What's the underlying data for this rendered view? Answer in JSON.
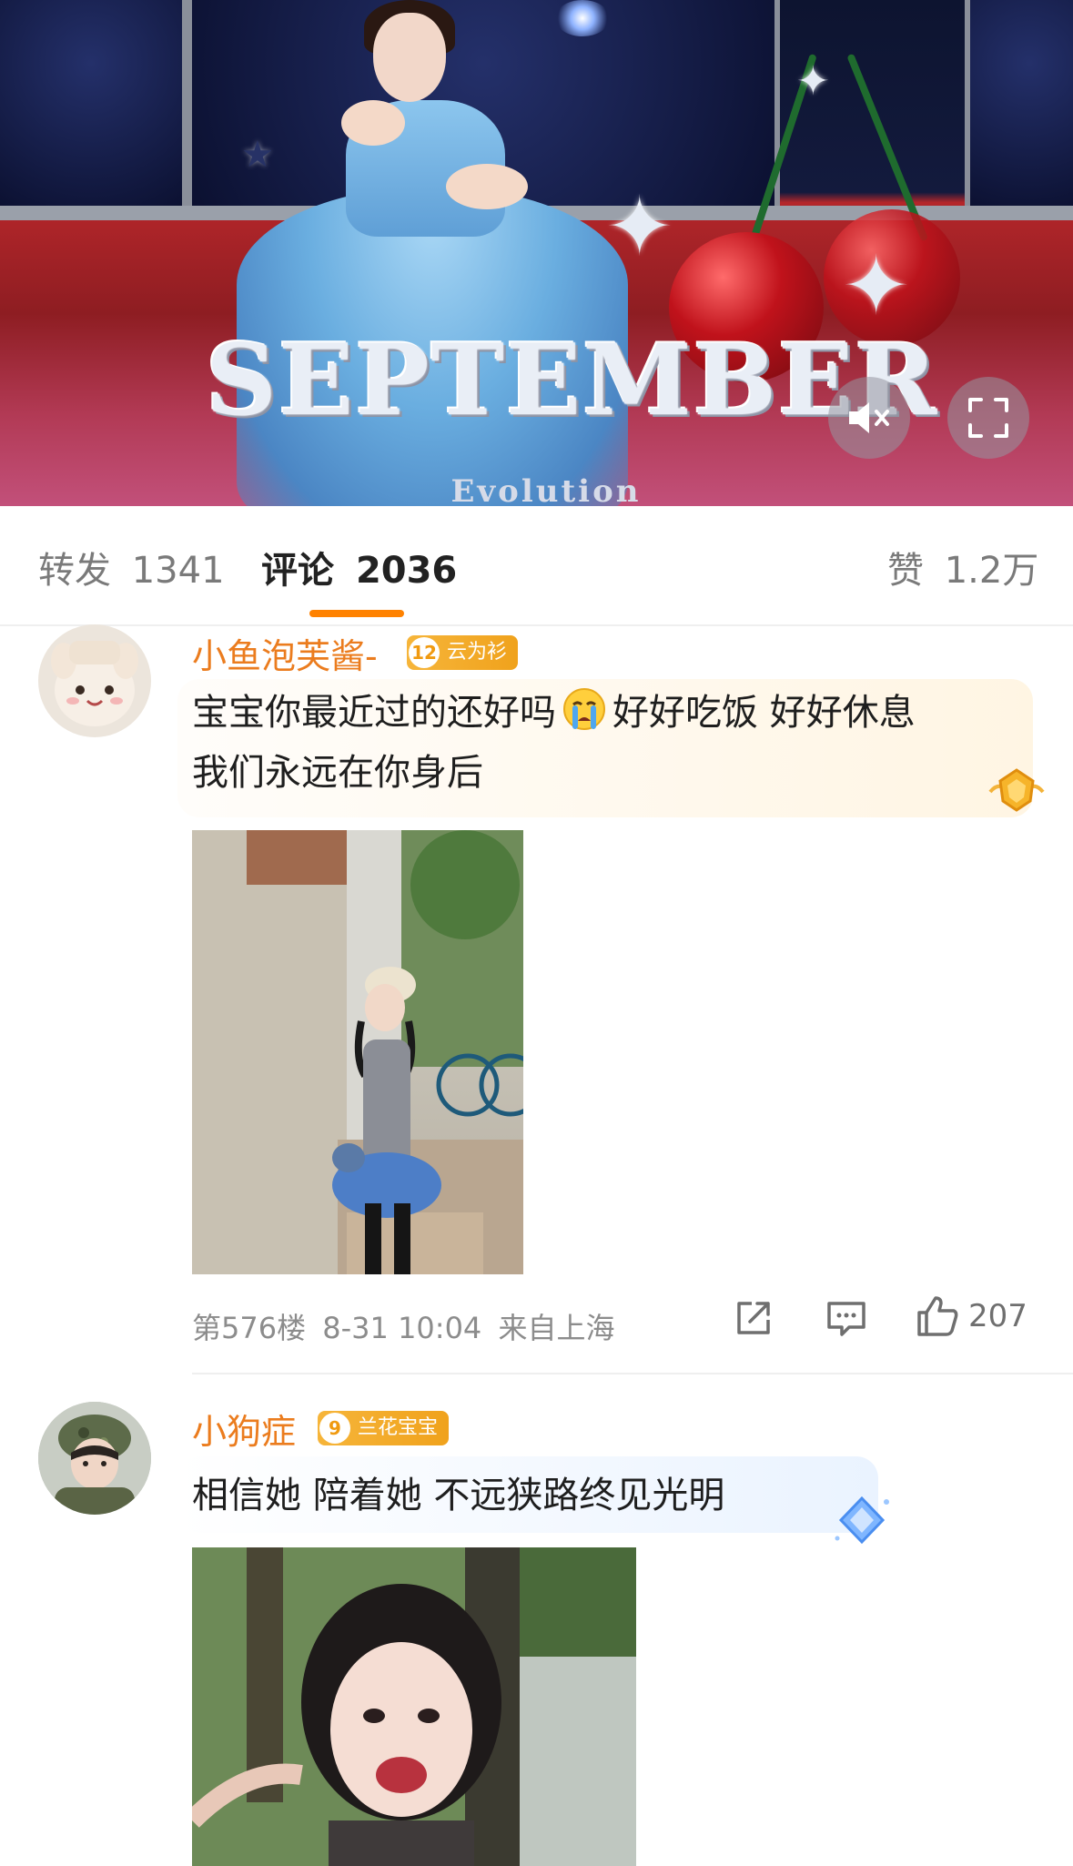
{
  "video": {
    "title_graphic_text": "SEPTEMBER",
    "subtitle_graphic_text": "Evolution",
    "mute_icon": "volume-mute-icon",
    "fullscreen_icon": "fullscreen-icon"
  },
  "tabs": {
    "repost": {
      "label": "转发",
      "count": "1341"
    },
    "comments": {
      "label": "评论",
      "count": "2036"
    },
    "likes": {
      "label": "赞",
      "count": "1.2万"
    },
    "active": "comments",
    "accent_color": "#ff8200"
  },
  "comments": [
    {
      "username": "小鱼泡芙酱-",
      "badge_level": "12",
      "badge_text": "云为衫",
      "text_line1": "宝宝你最近过的还好吗",
      "emoji": "crying-face",
      "text_line1b": "好好吃饭 好好休息",
      "text_line2": "我们永远在你身后",
      "floor": "第576楼",
      "time": "8-31 10:04",
      "location": "来自上海",
      "like_count": "207",
      "bubble_color": "#fff7ea",
      "badge_color": "#f3a42a"
    },
    {
      "username": "小狗症",
      "badge_level": "9",
      "badge_text": "兰花宝宝",
      "text_line1": "相信她 陪着她 不远狭路终见光明",
      "bubble_color": "#eef5ff",
      "badge_color": "#f3a42a"
    }
  ],
  "colors": {
    "username": "#eb7c1e",
    "meta_text": "#8c8c8c"
  }
}
